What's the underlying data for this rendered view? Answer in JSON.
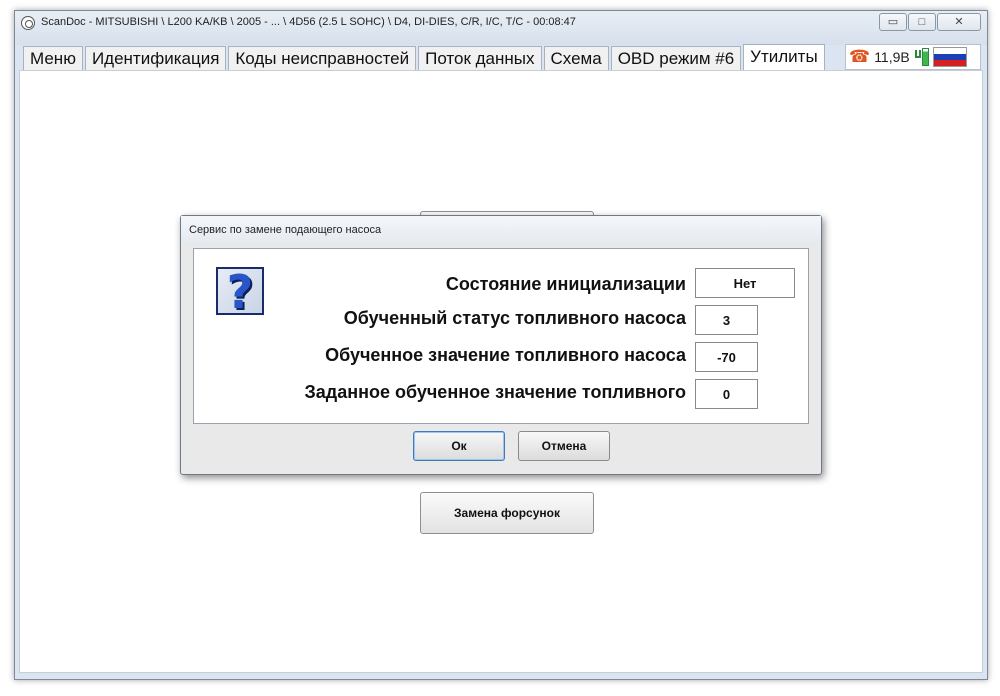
{
  "window": {
    "title": "ScanDoc - MITSUBISHI \\ L200 KA/KB \\ 2005 - ... \\ 4D56 (2.5 L SOHC) \\ D4, DI-DIES, C/R, I/C, T/C - 00:08:47",
    "minimize_label": "▭",
    "maximize_label": "□",
    "close_label": "✕"
  },
  "tabs": [
    {
      "label": "Меню"
    },
    {
      "label": "Идентификация"
    },
    {
      "label": "Коды неисправностей"
    },
    {
      "label": "Поток данных"
    },
    {
      "label": "Схема"
    },
    {
      "label": "OBD режим #6"
    },
    {
      "label": "Утилиты"
    }
  ],
  "status": {
    "voltage": "11,9В",
    "phone_icon": "phone-icon",
    "power_icon": "plug-battery-icon",
    "flag_icon": "russian-flag-icon"
  },
  "utilities": {
    "bottom_button": "Замена форсунок"
  },
  "dialog": {
    "title": "Сервис по замене подающего насоса",
    "rows": [
      {
        "label": "Состояние инициализации",
        "value": "Нет"
      },
      {
        "label": "Обученный статус топливного насоса",
        "value": "3"
      },
      {
        "label": "Обученное значение топливного насоса",
        "value": "-70"
      },
      {
        "label": "Заданное обученное значение топливного",
        "value": "0"
      }
    ],
    "ok_label": "Ок",
    "cancel_label": "Отмена"
  }
}
